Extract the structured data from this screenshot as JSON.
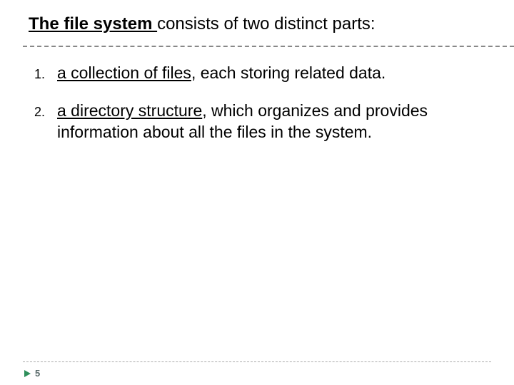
{
  "heading": {
    "underlined": "The  file system ",
    "normal": "consists of two distinct parts:"
  },
  "list": [
    {
      "number": "1.",
      "key": "a collection of files",
      "rest": ", each storing related data."
    },
    {
      "number": "2.",
      "key": "a directory structure",
      "rest": ", which organizes and provides information about  all the files in the system."
    }
  ],
  "page_number": "5"
}
